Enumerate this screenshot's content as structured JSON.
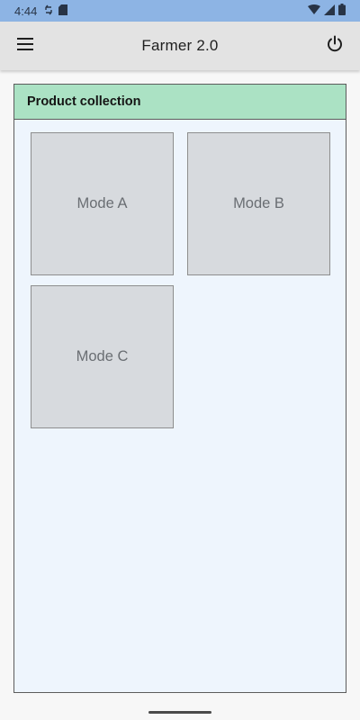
{
  "status_bar": {
    "time": "4:44",
    "left_icons": [
      "sync-icon",
      "sd-card-icon"
    ],
    "right_icons": [
      "wifi-icon",
      "signal-icon",
      "battery-icon"
    ]
  },
  "app_bar": {
    "title": "Farmer 2.0",
    "left_icon": "hamburger-menu-icon",
    "right_icon": "power-icon"
  },
  "panel": {
    "header": "Product collection",
    "modes": [
      {
        "label": "Mode A"
      },
      {
        "label": "Mode B"
      },
      {
        "label": "Mode C"
      }
    ]
  },
  "colors": {
    "status_bar": "#8db4e4",
    "app_bar": "#e3e3e3",
    "panel_header": "#abe2c4",
    "panel_body": "#eef5fd",
    "tile": "#d7dade",
    "tile_text": "#6a6e73"
  }
}
